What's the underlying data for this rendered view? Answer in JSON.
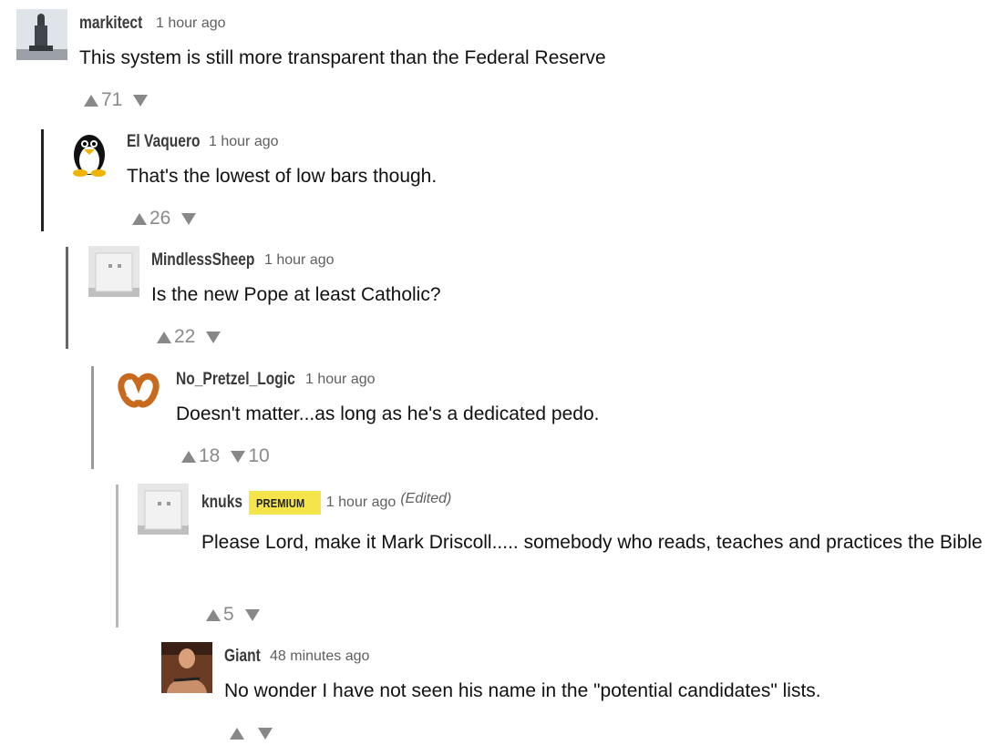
{
  "comments": [
    {
      "username": "markitect",
      "time": "1 hour ago",
      "text": "This system is still more transparent than the Federal Reserve",
      "upvotes": "71",
      "downvotes": "",
      "avatar": "statue-photo"
    },
    {
      "username": "El Vaquero",
      "time": "1 hour ago",
      "text": "That's the lowest of low bars though.",
      "upvotes": "26",
      "downvotes": "",
      "avatar": "penguin-icon"
    },
    {
      "username": "MindlessSheep",
      "time": "1 hour ago",
      "text": "Is the new Pope at least Catholic?",
      "upvotes": "22",
      "downvotes": "",
      "avatar": "default-avatar"
    },
    {
      "username": "No_Pretzel_Logic",
      "time": "1 hour ago",
      "text": "Doesn't matter...as long as he's a dedicated pedo.",
      "upvotes": "18",
      "downvotes": "10",
      "avatar": "pretzel-icon"
    },
    {
      "username": "knuks",
      "badge": "PREMIUM",
      "time": "1 hour ago",
      "edited": "(Edited)",
      "text": "Please Lord, make it Mark Driscoll..... somebody who reads, teaches and practices the Bible",
      "upvotes": "5",
      "downvotes": "",
      "avatar": "default-avatar"
    },
    {
      "username": "Giant",
      "time": "48 minutes ago",
      "text": "No wonder I have not seen his name in the \"potential candidates\" lists.",
      "upvotes": "",
      "downvotes": "",
      "avatar": "wrestler-photo"
    }
  ],
  "colors": {
    "thread_line_dark": "#222222",
    "thread_line_mid": "#555555",
    "thread_line_light": "#999999",
    "thread_line_lighter": "#bbbbbb",
    "badge": "#f5e54a",
    "vote_arrow": "#888888"
  }
}
